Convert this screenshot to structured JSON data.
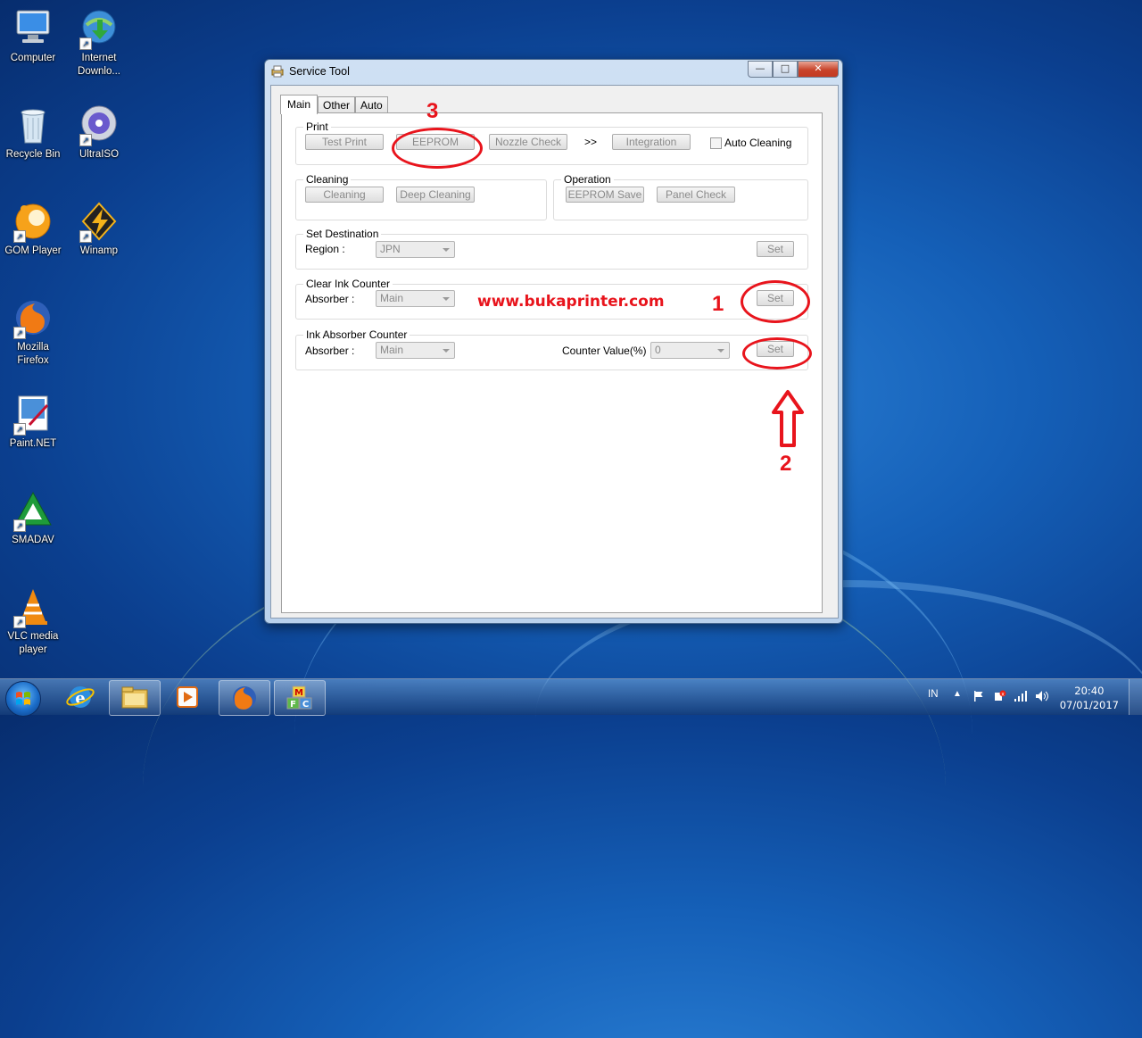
{
  "desktop": {
    "icons": [
      {
        "label": "Computer",
        "icon": "computer-icon"
      },
      {
        "label": "Internet Downlo...",
        "icon": "internet-download-manager-icon"
      },
      {
        "label": "Recycle Bin",
        "icon": "recycle-bin-icon"
      },
      {
        "label": "UltraISO",
        "icon": "ultraiso-icon"
      },
      {
        "label": "GOM Player",
        "icon": "gom-player-icon"
      },
      {
        "label": "Winamp",
        "icon": "winamp-icon"
      },
      {
        "label": "Mozilla Firefox",
        "icon": "firefox-icon"
      },
      {
        "label": "Paint.NET",
        "icon": "paint-net-icon"
      },
      {
        "label": "SMADAV",
        "icon": "smadav-icon"
      },
      {
        "label": "VLC media player",
        "icon": "vlc-icon"
      }
    ]
  },
  "window": {
    "title": "Service Tool",
    "tabs": [
      "Main",
      "Other",
      "Auto"
    ],
    "active_tab": "Main",
    "print": {
      "legend": "Print",
      "test_print": "Test Print",
      "eeprom": "EEPROM",
      "nozzle_check": "Nozzle Check",
      "arrow": ">>",
      "integration": "Integration",
      "auto_cleaning": "Auto Cleaning"
    },
    "cleaning": {
      "legend": "Cleaning",
      "cleaning": "Cleaning",
      "deep_cleaning": "Deep Cleaning"
    },
    "operation": {
      "legend": "Operation",
      "eeprom_save": "EEPROM Save",
      "panel_check": "Panel Check"
    },
    "set_destination": {
      "legend": "Set Destination",
      "region_label": "Region :",
      "region_value": "JPN",
      "set": "Set"
    },
    "clear_ink_counter": {
      "legend": "Clear Ink Counter",
      "absorber_label": "Absorber :",
      "absorber_value": "Main",
      "set": "Set"
    },
    "ink_absorber_counter": {
      "legend": "Ink Absorber Counter",
      "absorber_label": "Absorber :",
      "absorber_value": "Main",
      "counter_label": "Counter Value(%) :",
      "counter_value": "0",
      "set": "Set"
    }
  },
  "annotations": {
    "watermark": "www.bukaprinter.com",
    "num1": "1",
    "num2": "2",
    "num3": "3",
    "color": "#e8141c"
  },
  "taskbar": {
    "apps": [
      "start-orb",
      "internet-explorer-icon",
      "file-explorer-icon",
      "media-player-icon",
      "firefox-icon",
      "service-tool-app-icon"
    ],
    "language": "IN",
    "time": "20:40",
    "date": "07/01/2017"
  }
}
